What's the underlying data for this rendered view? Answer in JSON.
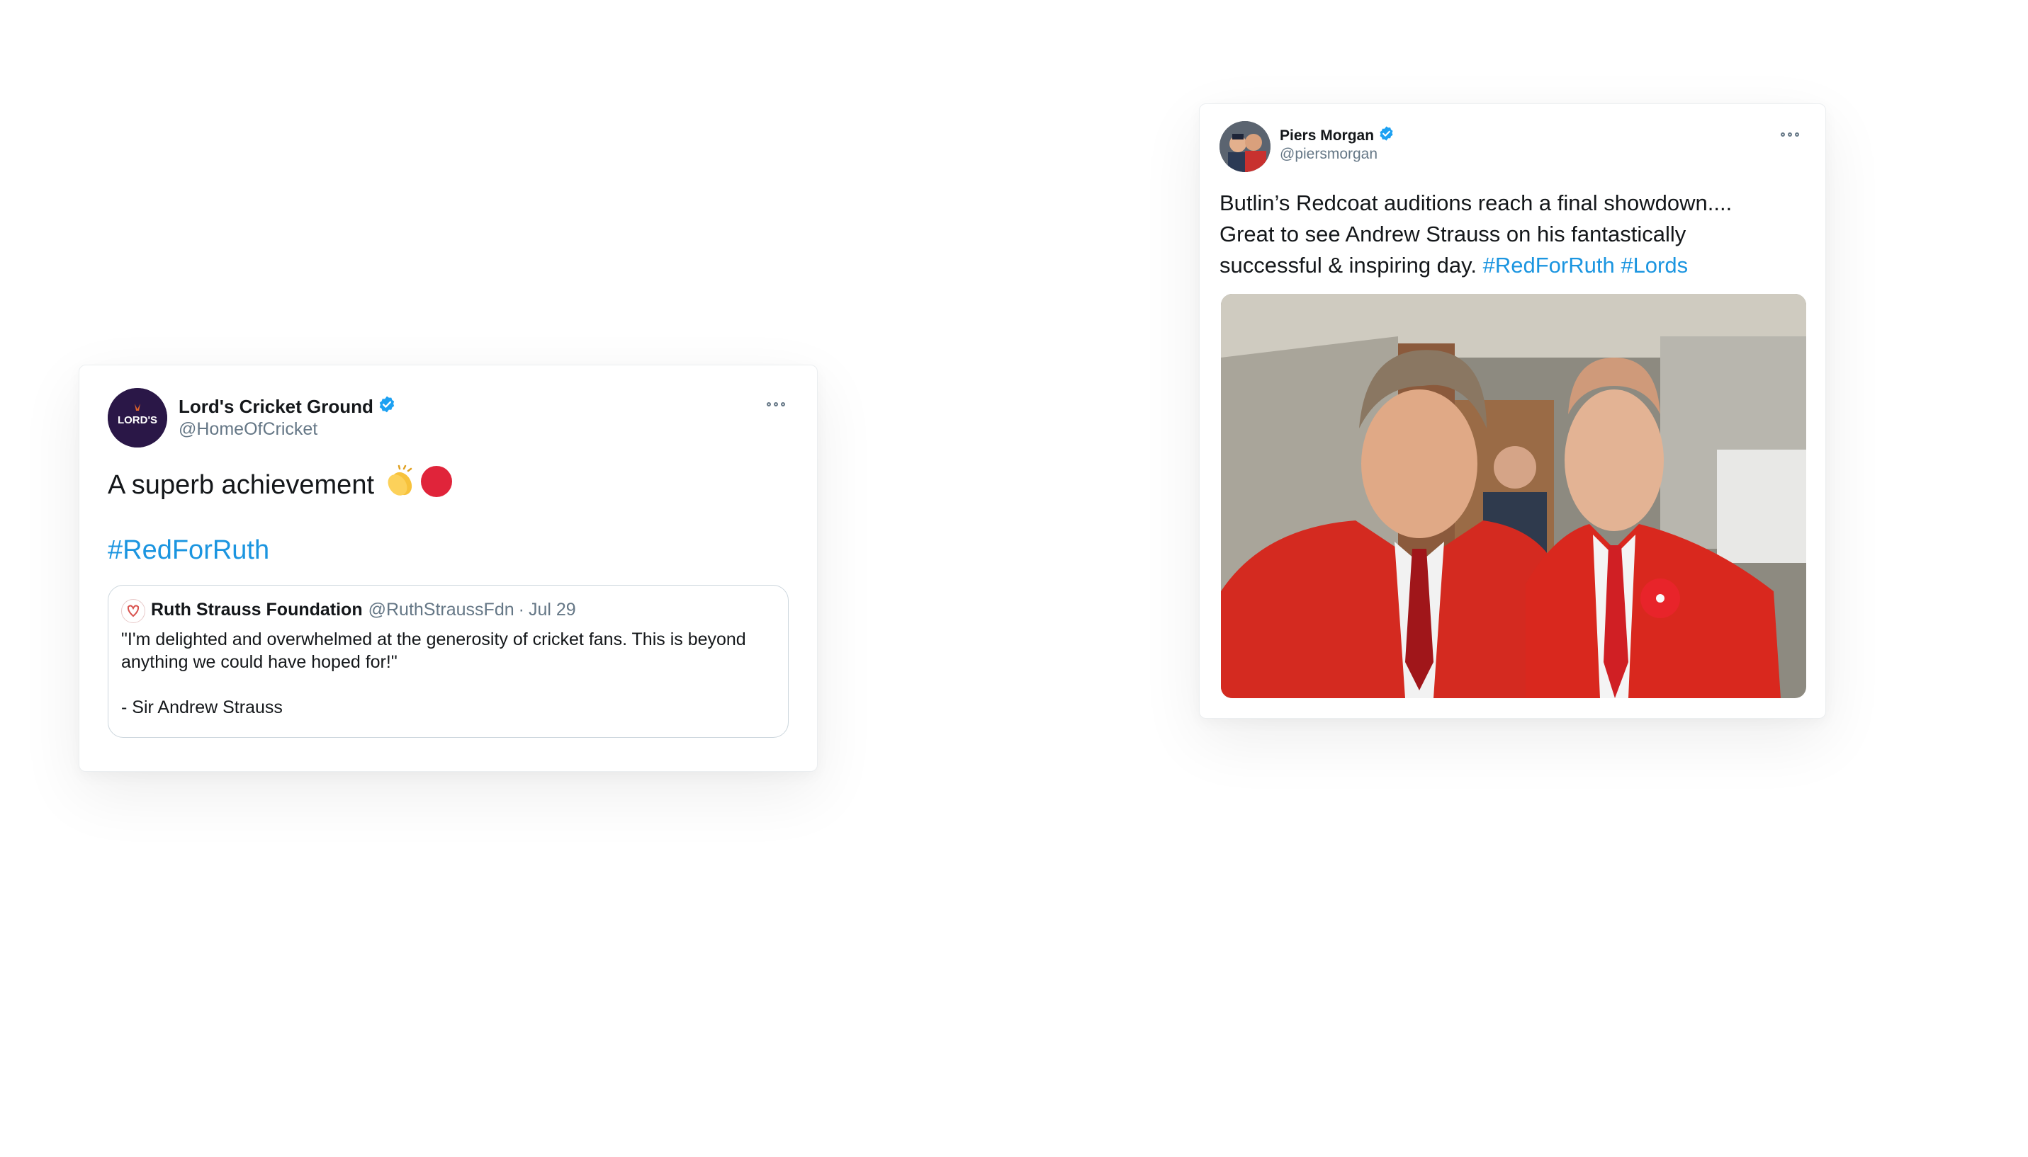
{
  "tweets": [
    {
      "author_name": "Lord's Cricket Ground",
      "author_handle": "@HomeOfCricket",
      "avatar_logo_text": "LORD'S",
      "text": "A superb achievement",
      "emojis": [
        "clapping-hands",
        "red-circle"
      ],
      "hashtag": "#RedForRuth",
      "quoted_tweet": {
        "author_name": "Ruth Strauss Foundation",
        "author_handle": "@RuthStraussFdn",
        "separator": "·",
        "date": "Jul 29",
        "body_line1": "\"I'm delighted and overwhelmed at the generosity of cricket fans. This is beyond anything we could have hoped for!\"",
        "signature": "- Sir Andrew Strauss"
      }
    },
    {
      "author_name": "Piers Morgan",
      "author_handle": "@piersmorgan",
      "text": "Butlin’s Redcoat auditions reach a final showdown.... Great to see Andrew Strauss on his fantastically successful & inspiring day.",
      "hashtags": [
        "#RedForRuth",
        "#Lords"
      ],
      "has_photo": true
    }
  ],
  "colors": {
    "hashtag": "#1b95e0",
    "verified": "#1da1f2",
    "secondary_text": "#657786"
  }
}
